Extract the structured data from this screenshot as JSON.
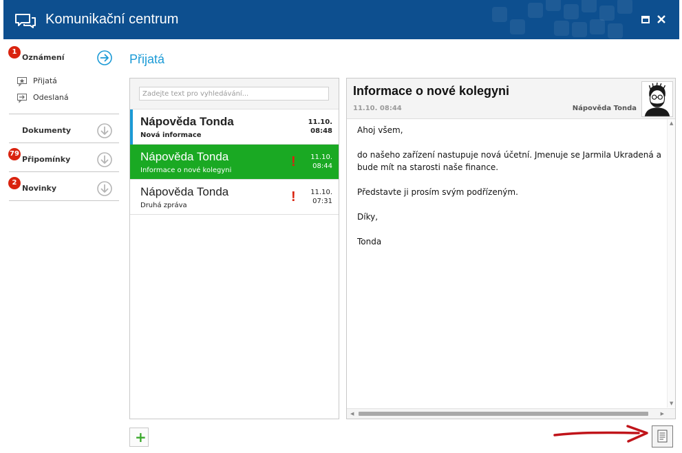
{
  "window": {
    "title": "Komunikační centrum"
  },
  "sidebar": {
    "oznameni": {
      "label": "Oznámení",
      "badge": "1"
    },
    "subitems": [
      {
        "label": "Přijatá"
      },
      {
        "label": "Odeslaná"
      }
    ],
    "dokumenty": {
      "label": "Dokumenty"
    },
    "pripominky": {
      "label": "Připomínky",
      "badge": "79"
    },
    "novinky": {
      "label": "Novinky",
      "badge": "2"
    }
  },
  "folder": {
    "title": "Přijatá"
  },
  "search": {
    "placeholder": "Zadejte text pro vyhledávání..."
  },
  "messages": [
    {
      "sender": "Nápověda Tonda",
      "subject": "Nová informace",
      "date": "11.10.",
      "time": "08:48",
      "flag": ""
    },
    {
      "sender": "Nápověda Tonda",
      "subject": "Informace o nové kolegyni",
      "date": "11.10.",
      "time": "08:44",
      "flag": "!"
    },
    {
      "sender": "Nápověda Tonda",
      "subject": "Druhá zpráva",
      "date": "11.10.",
      "time": "07:31",
      "flag": "!"
    }
  ],
  "reader": {
    "subject": "Informace o nové kolegyni",
    "datetime": "11.10. 08:44",
    "sender": "Nápověda Tonda",
    "body": [
      "Ahoj všem,",
      "do našeho zařízení nastupuje nová účetní. Jmenuje se Jarmila Ukradená a bude mít na starosti naše finance.",
      "Představte ji prosím svým podřízeným.",
      "Díky,",
      "Tonda"
    ]
  },
  "toolbar": {
    "add_label": "+"
  },
  "colors": {
    "titlebar": "#0d4f8f",
    "accent": "#1b9ad6",
    "selected_row": "#1aa923",
    "badge": "#d9230f",
    "flag": "#d9230f",
    "add_green": "#3aa82b",
    "annotation_arrow": "#c0141a"
  },
  "icons": {
    "app": "chat-bubbles-icon",
    "oznameni_action": "arrow-right-circle-icon",
    "section_action": "arrow-down-circle-icon",
    "inbox": "inbox-star-icon",
    "sent": "outbox-arrow-icon",
    "maximize": "maximize-icon",
    "close": "close-icon",
    "document": "document-icon",
    "avatar": "user-avatar-sketch"
  }
}
